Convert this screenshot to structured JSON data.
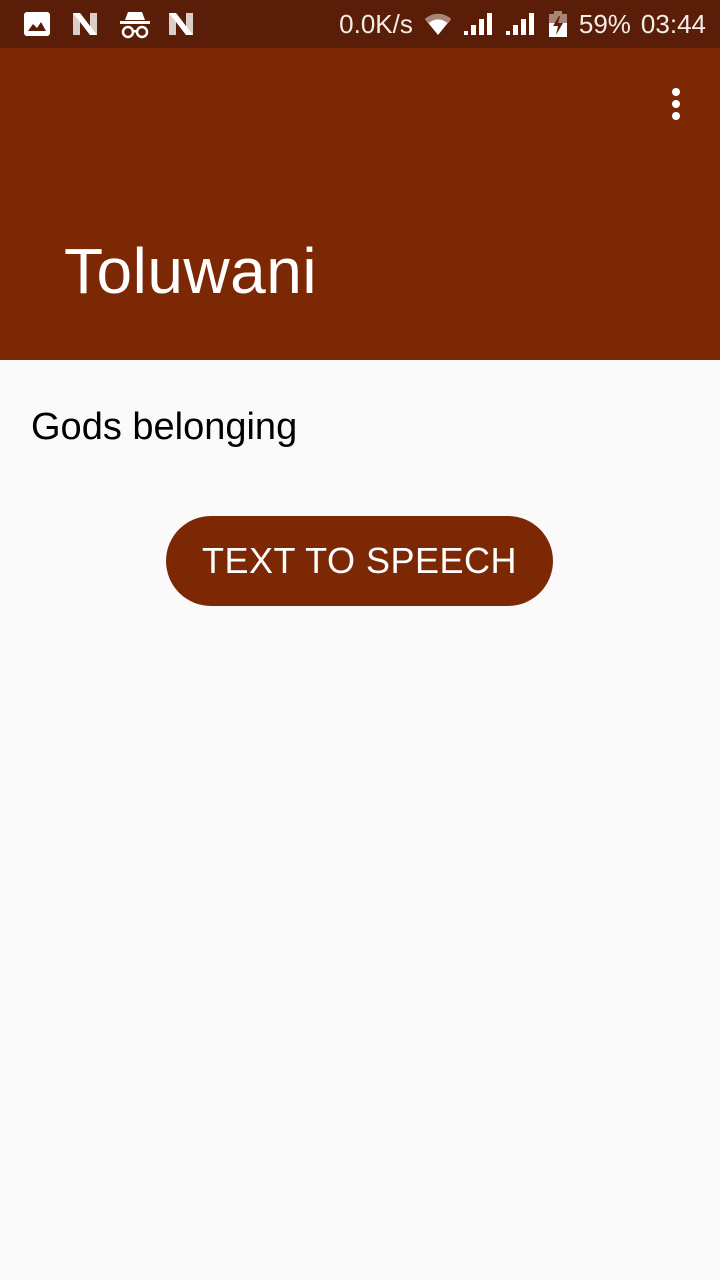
{
  "status_bar": {
    "left_icons": [
      "gallery-icon",
      "n-icon",
      "incognito-icon",
      "n-icon"
    ],
    "network_speed": "0.0K/s",
    "battery_percent": "59%",
    "time": "03:44",
    "right_icons": [
      "wifi-icon",
      "signal-icon",
      "signal-icon",
      "battery-charging-icon"
    ]
  },
  "app_bar": {
    "title": "Toluwani",
    "overflow_menu_icon": "more-vert-icon",
    "color": "#7d2804"
  },
  "content": {
    "text": "Gods belonging",
    "button_label": "TEXT TO SPEECH"
  },
  "colors": {
    "primary": "#7d2804",
    "primary_dark": "#5a1d08",
    "background": "#fafafa"
  }
}
